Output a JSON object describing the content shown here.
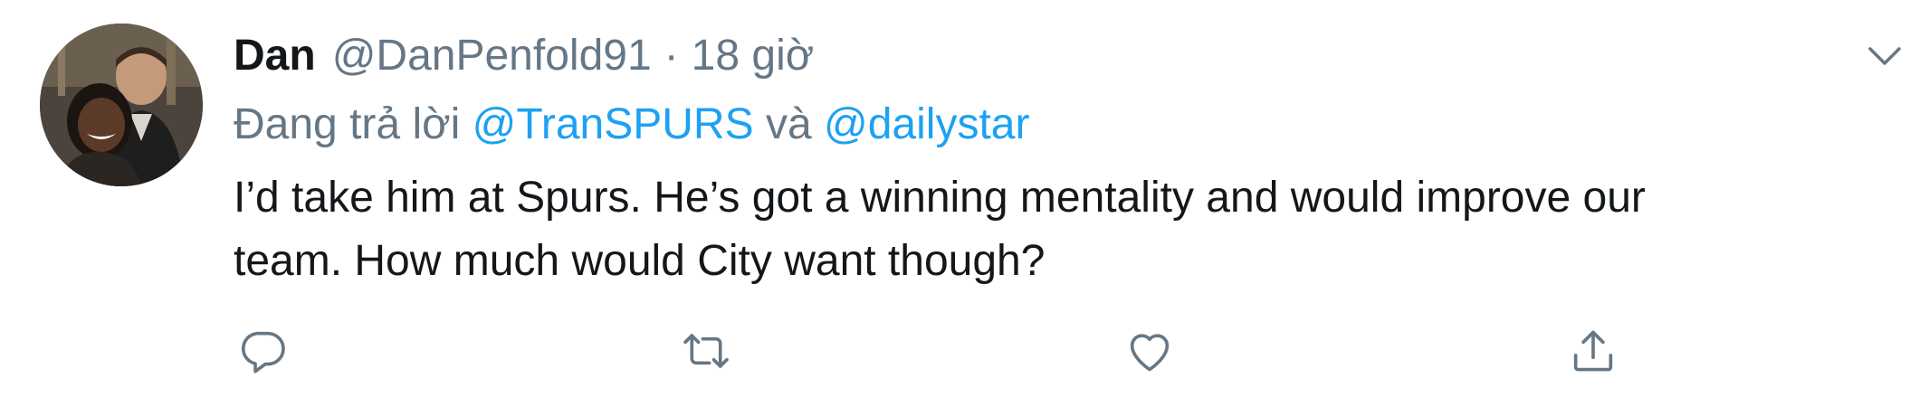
{
  "tweet": {
    "display_name": "Dan",
    "handle": "@DanPenfold91",
    "separator": "·",
    "time": "18 giờ",
    "reply_prefix": "Đang trả lời",
    "reply_mention_1": "@TranSPURS",
    "reply_conjunction": "và",
    "reply_mention_2": "@dailystar",
    "text_line_1": "I’d take him at Spurs. He’s got a winning mentality and would improve our",
    "text_line_2": "team. How much would City want though?"
  },
  "icons": {
    "caret": "chevron-down-icon",
    "reply": "reply-icon",
    "retweet": "retweet-icon",
    "like": "heart-icon",
    "share": "share-icon"
  },
  "colors": {
    "text": "#14171a",
    "secondary": "#657786",
    "link": "#1da1f2"
  }
}
